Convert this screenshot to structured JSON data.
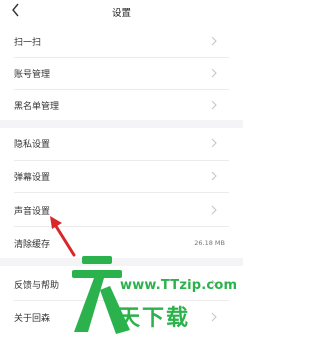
{
  "header": {
    "title": "设置"
  },
  "groups": [
    {
      "items": [
        {
          "label": "扫一扫",
          "chevron": true
        },
        {
          "label": "账号管理",
          "chevron": true
        },
        {
          "label": "黑名单管理",
          "chevron": true
        }
      ]
    },
    {
      "items": [
        {
          "label": "隐私设置",
          "chevron": true
        },
        {
          "label": "弹幕设置",
          "chevron": true
        },
        {
          "label": "声音设置",
          "chevron": true
        },
        {
          "label": "清除缓存",
          "value": "26.18 MB"
        }
      ]
    },
    {
      "items": [
        {
          "label": "反馈与帮助",
          "chevron": true
        },
        {
          "label": "关于回森",
          "chevron": true
        }
      ]
    }
  ],
  "watermark": {
    "url": "www.TTzip.com",
    "brand": "天下载"
  },
  "colors": {
    "accent_arrow": "#d9262b",
    "watermark": "#2bb24c",
    "section_gap": "#f4f4f6"
  }
}
